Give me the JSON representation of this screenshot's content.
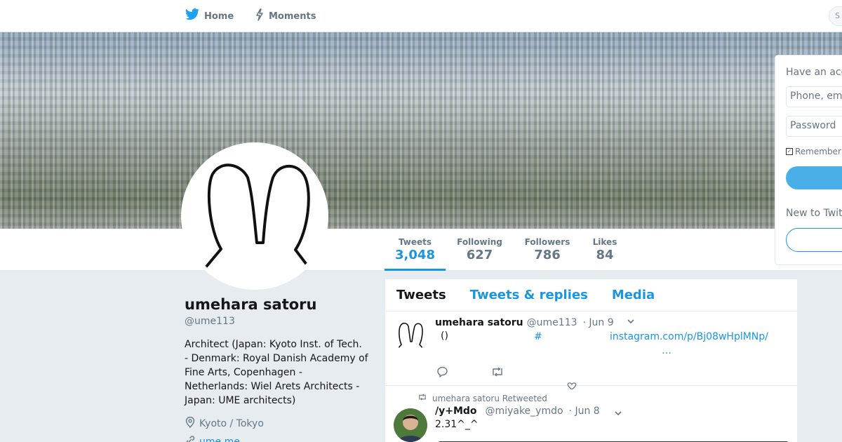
{
  "nav": {
    "home_label": "Home",
    "moments_label": "Moments",
    "search_placeholder": "S"
  },
  "profile": {
    "name": "umehara satoru",
    "handle": "@ume113",
    "bio": "Architect (Japan: Kyoto Inst. of Tech. - Denmark: Royal Danish Academy of Fine Arts, Copenhagen - Netherlands: Wiel Arets Architects - Japan: UME architects)",
    "location": "Kyoto / Tokyo",
    "url": "ume.me"
  },
  "stats": {
    "tweets_label": "Tweets",
    "tweets_value": "3,048",
    "following_label": "Following",
    "following_value": "627",
    "followers_label": "Followers",
    "followers_value": "786",
    "likes_label": "Likes",
    "likes_value": "84"
  },
  "timeline": {
    "tabs": [
      "Tweets",
      "Tweets & replies",
      "Media"
    ],
    "active_tab": "Tweets",
    "tweets": [
      {
        "name": "umehara satoru",
        "handle": "@ume113",
        "time": "· Jun 9",
        "text": "()",
        "hashtag": "#",
        "link": "instagram.com/p/Bj08wHplMNp/",
        "ellipsis": "…"
      },
      {
        "retweet_context": "umehara satoru Retweeted",
        "name": "/y+Mdo",
        "handle": "@miyake_ymdo",
        "time": "· Jun 8",
        "text": "2.31^_^"
      }
    ]
  },
  "login": {
    "title": "Have an account?",
    "phone_placeholder": "Phone, email or username",
    "password_placeholder": "Password",
    "remember": "Remember me",
    "new_prompt": "New to Twitter?"
  },
  "colors": {
    "accent": "#1b95e0",
    "text_secondary": "#657786",
    "background": "#e6ecf0"
  }
}
